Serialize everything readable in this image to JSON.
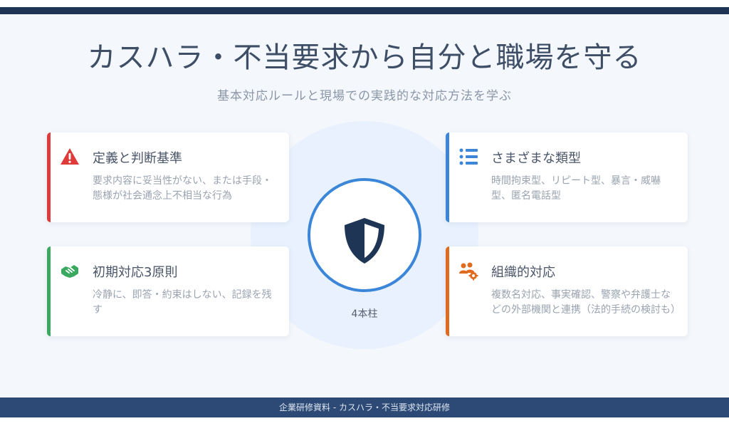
{
  "header": {
    "title": "カスハラ・不当要求から自分と職場を守る",
    "subtitle": "基本対応ルールと現場での実践的な対応方法を学ぶ"
  },
  "center": {
    "icon": "shield-icon",
    "label": "4本柱"
  },
  "cards": [
    {
      "title": "定義と判断基準",
      "description": "要求内容に妥当性がない、または手段・態様が社会通念上不相当な行為",
      "icon": "warning-icon",
      "color": "#e03b3b"
    },
    {
      "title": "さまざまな類型",
      "description": "時間拘束型、リピート型、暴言・威嚇型、匿名電話型",
      "icon": "list-icon",
      "color": "#3b86d8"
    },
    {
      "title": "初期対応3原則",
      "description": "冷静に、即答・約束はしない、記録を残す",
      "icon": "handshake-icon",
      "color": "#3aa85f"
    },
    {
      "title": "組織的対応",
      "description": "複数名対応、事実確認、警察や弁護士などの外部機関と連携（法的手続の検討も）",
      "icon": "team-gear-icon",
      "color": "#e06b1f"
    }
  ],
  "footer": {
    "text": "企業研修資料 - カスハラ・不当要求対応研修"
  }
}
